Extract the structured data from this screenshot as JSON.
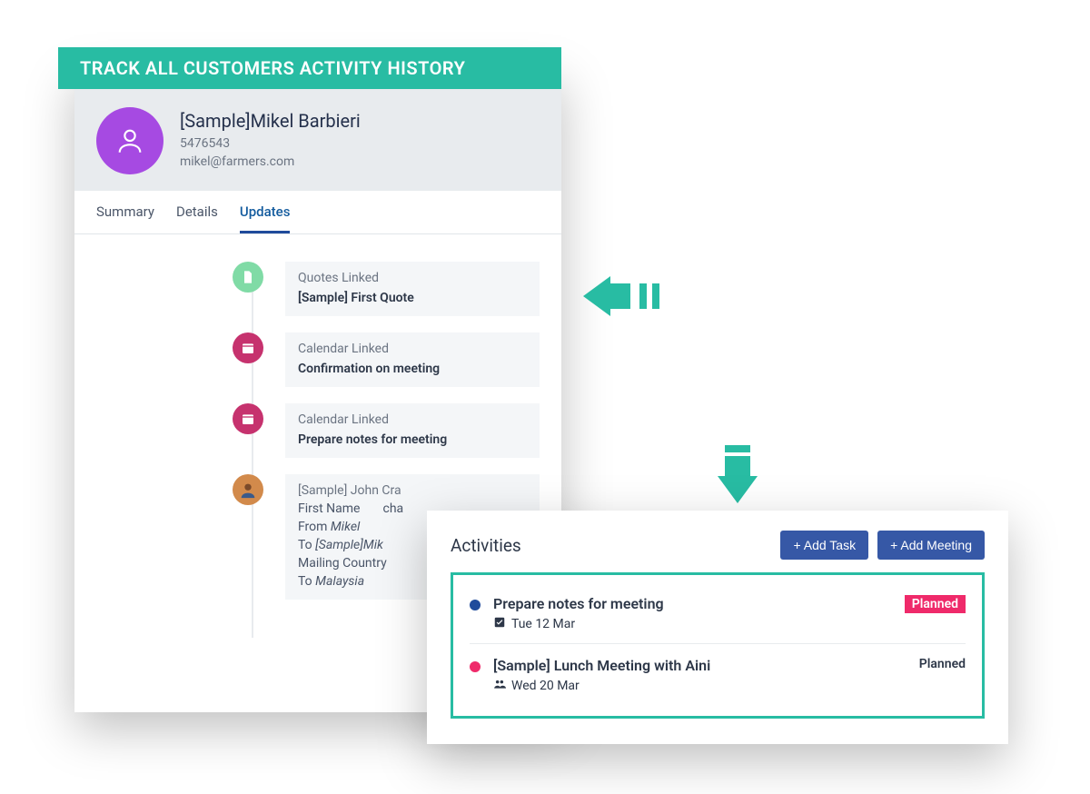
{
  "banner": "TRACK ALL CUSTOMERS ACTIVITY HISTORY",
  "customer": {
    "name": "[Sample]Mikel Barbieri",
    "id": "5476543",
    "email": "mikel@farmers.com"
  },
  "tabs": {
    "summary": "Summary",
    "details": "Details",
    "updates": "Updates"
  },
  "timeline": [
    {
      "icon": "file-icon",
      "dotColor": "green",
      "typeLabel": "Quotes",
      "linkedLabel": "Linked",
      "title": "[Sample] First Quote"
    },
    {
      "icon": "calendar-icon",
      "dotColor": "pink",
      "typeLabel": "Calendar",
      "linkedLabel": "Linked",
      "title": "Confirmation on meeting"
    },
    {
      "icon": "calendar-icon",
      "dotColor": "pink",
      "typeLabel": "Calendar",
      "linkedLabel": "Linked",
      "title": "Prepare notes for meeting"
    },
    {
      "icon": "avatar-icon",
      "dotColor": "avatar",
      "typeLabel": "[Sample] John Cra",
      "changes": [
        {
          "field": "First Name",
          "action": "cha"
        },
        {
          "from": "Mikel",
          "to": "[Sample]Mik"
        },
        {
          "field": "Mailing Country"
        },
        {
          "to": "Malaysia"
        }
      ]
    }
  ],
  "activities": {
    "title": "Activities",
    "addTask": "+ Add Task",
    "addMeeting": "+ Add Meeting",
    "items": [
      {
        "bullet": "blue",
        "name": "Prepare notes for meeting",
        "icon": "check-icon",
        "date": "Tue 12 Mar",
        "status": "Planned",
        "highlight": true
      },
      {
        "bullet": "pink",
        "name": "[Sample] Lunch Meeting with Aini",
        "icon": "people-icon",
        "date": "Wed 20 Mar",
        "status": "Planned",
        "highlight": false
      }
    ]
  },
  "labels": {
    "from": "From",
    "to": "To"
  }
}
